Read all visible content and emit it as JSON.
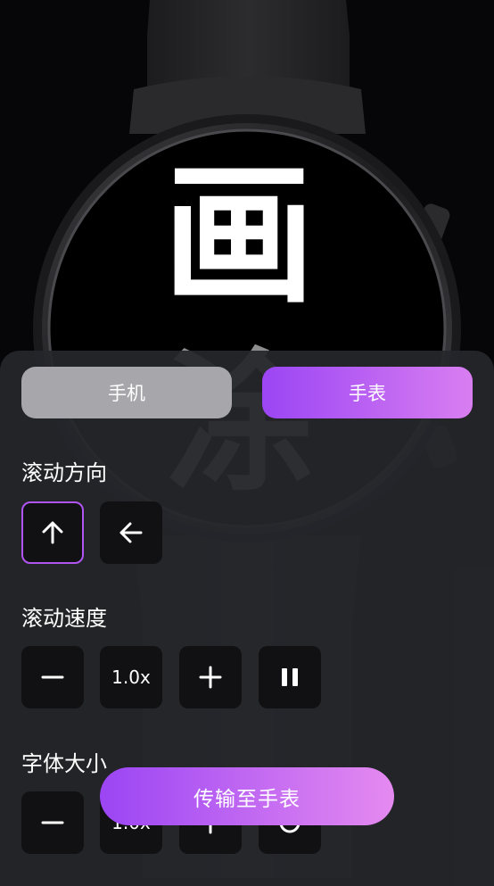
{
  "preview": {
    "scroll_char_1": "画",
    "scroll_char_2": "涂"
  },
  "tabs": [
    {
      "label": "手机",
      "active": false
    },
    {
      "label": "手表",
      "active": true
    }
  ],
  "scroll_direction": {
    "title": "滚动方向",
    "options": [
      {
        "icon": "arrow-up-icon",
        "selected": true
      },
      {
        "icon": "arrow-left-icon",
        "selected": false
      }
    ]
  },
  "scroll_speed": {
    "title": "滚动速度",
    "value": "1.0x",
    "decrease_icon": "minus-icon",
    "increase_icon": "plus-icon",
    "pause_icon": "pause-icon"
  },
  "font_size": {
    "title": "字体大小",
    "value": "1.0x",
    "decrease_icon": "minus-icon",
    "increase_icon": "plus-icon",
    "extra_icon": "reset-icon"
  },
  "transfer_button": "传输至手表",
  "colors": {
    "accent_start": "#9b45f4",
    "accent_end": "#e58af0",
    "panel": "#26272b",
    "tile": "#111113",
    "tab_inactive": "#a7a6ab"
  }
}
